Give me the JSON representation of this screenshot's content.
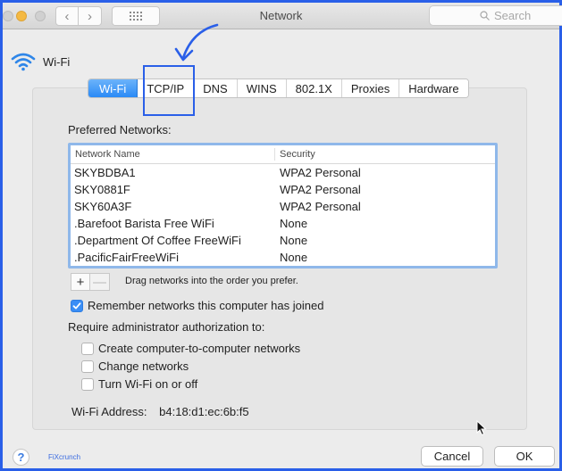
{
  "window": {
    "title": "Network",
    "search_placeholder": "Search"
  },
  "header": {
    "interface_label": "Wi-Fi"
  },
  "tabs": [
    {
      "label": "Wi-Fi",
      "active": true
    },
    {
      "label": "TCP/IP",
      "active": false
    },
    {
      "label": "DNS",
      "active": false
    },
    {
      "label": "WINS",
      "active": false
    },
    {
      "label": "802.1X",
      "active": false
    },
    {
      "label": "Proxies",
      "active": false
    },
    {
      "label": "Hardware",
      "active": false
    }
  ],
  "preferred_networks": {
    "label": "Preferred Networks:",
    "columns": [
      "Network Name",
      "Security"
    ],
    "rows": [
      {
        "name": "SKYBDBA1",
        "security": "WPA2 Personal"
      },
      {
        "name": "SKY0881F",
        "security": "WPA2 Personal"
      },
      {
        "name": "SKY60A3F",
        "security": "WPA2 Personal"
      },
      {
        "name": ".Barefoot Barista Free WiFi",
        "security": "None"
      },
      {
        "name": ".Department Of Coffee FreeWiFi",
        "security": "None"
      },
      {
        "name": ".PacificFairFreeWiFi",
        "security": "None"
      }
    ],
    "add_label": "+",
    "remove_label": "—",
    "hint": "Drag networks into the order you prefer."
  },
  "options": {
    "remember": {
      "label": "Remember networks this computer has joined",
      "checked": true
    },
    "require_admin_label": "Require administrator authorization to:",
    "admin_items": [
      {
        "label": "Create computer-to-computer networks",
        "checked": false
      },
      {
        "label": "Change networks",
        "checked": false
      },
      {
        "label": "Turn Wi-Fi on or off",
        "checked": false
      }
    ]
  },
  "address": {
    "label": "Wi-Fi Address:",
    "value": "b4:18:d1:ec:6b:f5"
  },
  "footer": {
    "help_label": "?",
    "watermark": "FiXcrunch",
    "cancel_label": "Cancel",
    "ok_label": "OK"
  },
  "colors": {
    "accent": "#2a8af6",
    "annotation": "#2a5fe8",
    "minimize": "#f5b942"
  }
}
